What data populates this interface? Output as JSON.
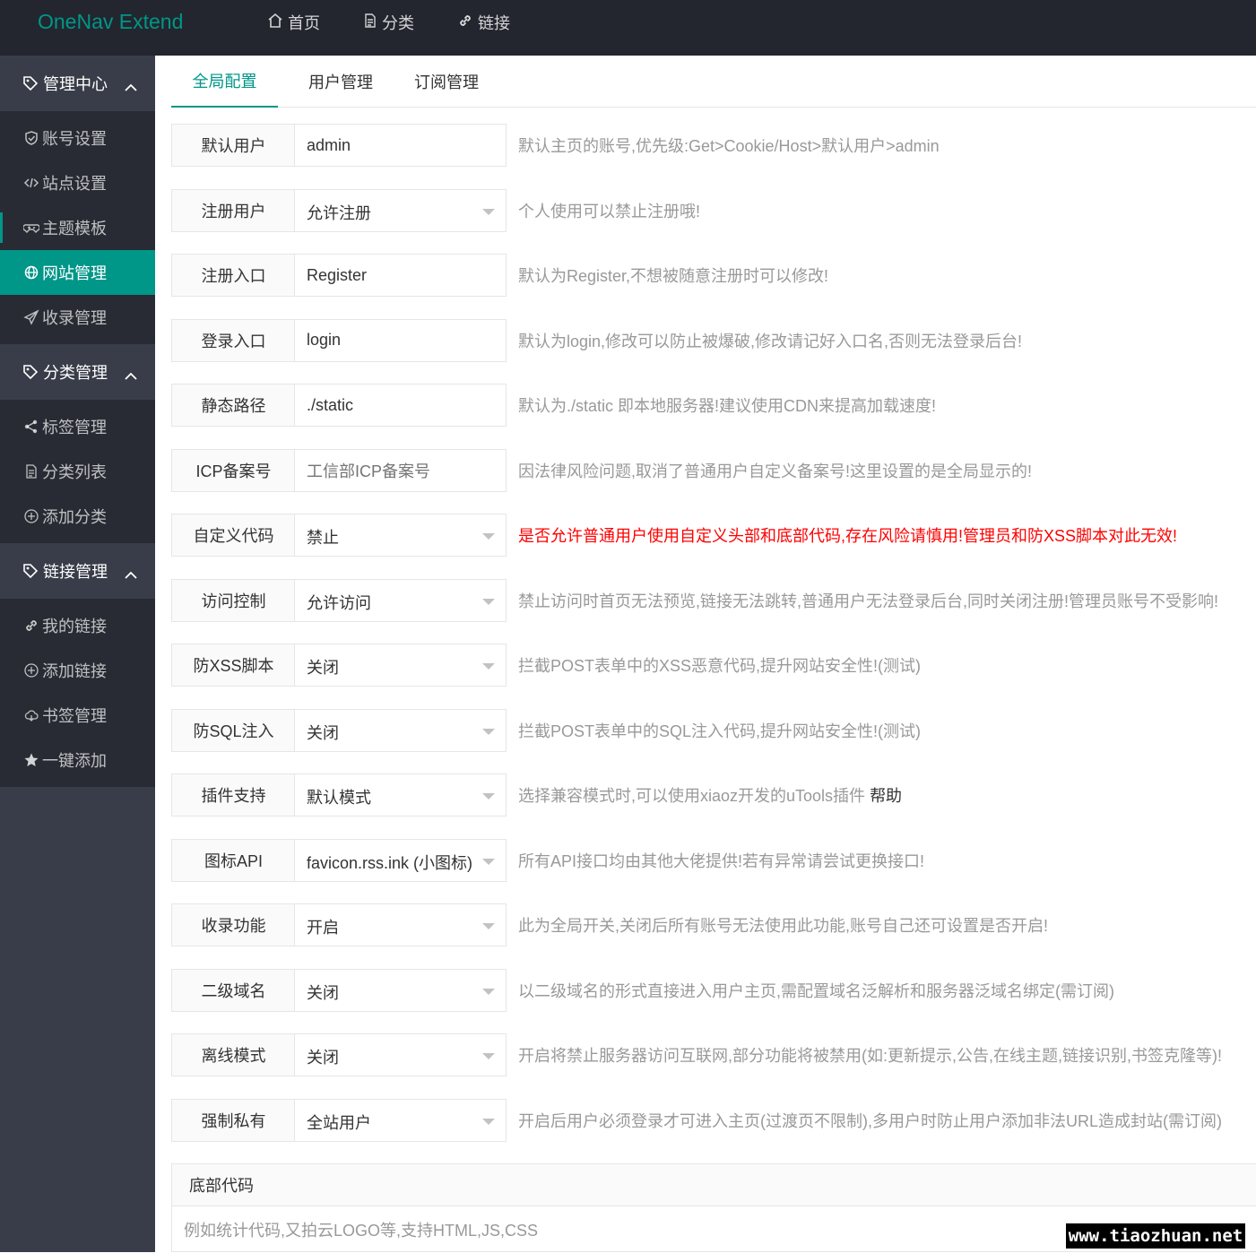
{
  "app": {
    "title": "OneNav Extend"
  },
  "topnav": [
    {
      "label": "首页",
      "icon": "home-icon"
    },
    {
      "label": "分类",
      "icon": "file-icon"
    },
    {
      "label": "链接",
      "icon": "link-icon"
    }
  ],
  "sidebar": {
    "groups": [
      {
        "label": "管理中心",
        "icon": "tag-icon",
        "items": [
          {
            "label": "账号设置",
            "icon": "shield-icon"
          },
          {
            "label": "站点设置",
            "icon": "code-icon"
          },
          {
            "label": "主题模板",
            "icon": "gamepad-icon"
          },
          {
            "label": "网站管理",
            "icon": "globe-icon",
            "active": true
          },
          {
            "label": "收录管理",
            "icon": "send-icon"
          }
        ]
      },
      {
        "label": "分类管理",
        "icon": "tag-icon",
        "items": [
          {
            "label": "标签管理",
            "icon": "share-icon"
          },
          {
            "label": "分类列表",
            "icon": "file-icon"
          },
          {
            "label": "添加分类",
            "icon": "add-circle-icon"
          }
        ]
      },
      {
        "label": "链接管理",
        "icon": "tag-icon",
        "items": [
          {
            "label": "我的链接",
            "icon": "link-icon"
          },
          {
            "label": "添加链接",
            "icon": "add-circle-icon"
          },
          {
            "label": "书签管理",
            "icon": "cloud-icon"
          },
          {
            "label": "一键添加",
            "icon": "star-icon"
          }
        ]
      }
    ]
  },
  "tabs": [
    {
      "label": "全局配置",
      "active": true
    },
    {
      "label": "用户管理"
    },
    {
      "label": "订阅管理"
    }
  ],
  "form": {
    "rows": [
      {
        "label": "默认用户",
        "type": "input",
        "value": "admin",
        "tip": "默认主页的账号,优先级:Get>Cookie/Host>默认用户>admin"
      },
      {
        "label": "注册用户",
        "type": "select",
        "value": "允许注册",
        "tip": "个人使用可以禁止注册哦!"
      },
      {
        "label": "注册入口",
        "type": "input",
        "value": "Register",
        "tip": "默认为Register,不想被随意注册时可以修改!"
      },
      {
        "label": "登录入口",
        "type": "input",
        "value": "login",
        "tip": "默认为login,修改可以防止被爆破,修改请记好入口名,否则无法登录后台!"
      },
      {
        "label": "静态路径",
        "type": "input",
        "value": "./static",
        "tip": "默认为./static 即本地服务器!建议使用CDN来提高加载速度!"
      },
      {
        "label": "ICP备案号",
        "type": "input",
        "value": "",
        "placeholder": "工信部ICP备案号",
        "tip": "因法律风险问题,取消了普通用户自定义备案号!这里设置的是全局显示的!"
      },
      {
        "label": "自定义代码",
        "type": "select",
        "value": "禁止",
        "tip": "是否允许普通用户使用自定义头部和底部代码,存在风险请慎用!管理员和防XSS脚本对此无效!",
        "tip_color": "#ff0000"
      },
      {
        "label": "访问控制",
        "type": "select",
        "value": "允许访问",
        "tip": "禁止访问时首页无法预览,链接无法跳转,普通用户无法登录后台,同时关闭注册!管理员账号不受影响!"
      },
      {
        "label": "防XSS脚本",
        "type": "select",
        "value": "关闭",
        "tip": "拦截POST表单中的XSS恶意代码,提升网站安全性!(测试)"
      },
      {
        "label": "防SQL注入",
        "type": "select",
        "value": "关闭",
        "tip": "拦截POST表单中的SQL注入代码,提升网站安全性!(测试)"
      },
      {
        "label": "插件支持",
        "type": "select",
        "value": "默认模式",
        "tip": "选择兼容模式时,可以使用xiaoz开发的uTools插件",
        "help": "帮助"
      },
      {
        "label": "图标API",
        "type": "select",
        "value": "favicon.rss.ink (小图标)",
        "tip": "所有API接口均由其他大佬提供!若有异常请尝试更换接口!"
      },
      {
        "label": "收录功能",
        "type": "select",
        "value": "开启",
        "tip": "此为全局开关,关闭后所有账号无法使用此功能,账号自己还可设置是否开启!"
      },
      {
        "label": "二级域名",
        "type": "select",
        "value": "关闭",
        "tip": "以二级域名的形式直接进入用户主页,需配置域名泛解析和服务器泛域名绑定(需订阅)"
      },
      {
        "label": "离线模式",
        "type": "select",
        "value": "关闭",
        "tip": "开启将禁止服务器访问互联网,部分功能将被禁用(如:更新提示,公告,在线主题,链接识别,书签克隆等)!"
      },
      {
        "label": "强制私有",
        "type": "select",
        "value": "全站用户",
        "tip": "开启后用户必须登录才可进入主页(过渡页不限制),多用户时防止用户添加非法URL造成封站(需订阅)"
      }
    ]
  },
  "footer_code": {
    "label": "底部代码",
    "placeholder": "例如统计代码,又拍云LOGO等,支持HTML,JS,CSS"
  },
  "watermark": "www.tiaozhuan.net",
  "colors": {
    "accent": "#009688",
    "topbar": "#23262e",
    "sidebar": "#393d49",
    "sidebar_sub": "#282b33",
    "warning": "#ff0000"
  }
}
